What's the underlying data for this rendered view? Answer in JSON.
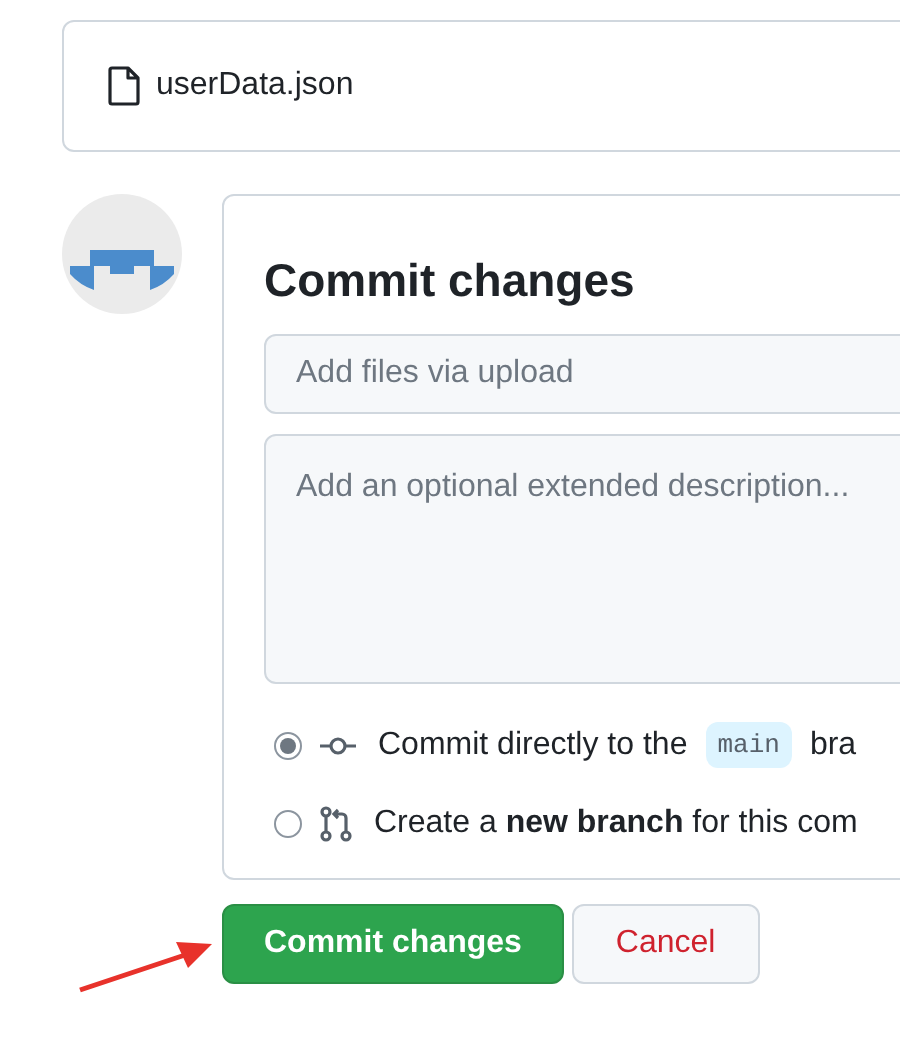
{
  "file": {
    "name": "userData.json"
  },
  "commit": {
    "title": "Commit changes",
    "summary": {
      "placeholder": "Add files via upload"
    },
    "description": {
      "placeholder": "Add an optional extended description..."
    },
    "options": [
      {
        "kind": "direct",
        "selected": true,
        "text": "Commit directly to the",
        "branch": "main",
        "suffix": "bra"
      },
      {
        "kind": "new-branch",
        "selected": false,
        "text": "Create a **new branch** for this com"
      }
    ]
  },
  "buttons": [
    {
      "kind": "primary",
      "label": "Commit changes"
    },
    {
      "kind": "danger",
      "label": "Cancel"
    }
  ]
}
